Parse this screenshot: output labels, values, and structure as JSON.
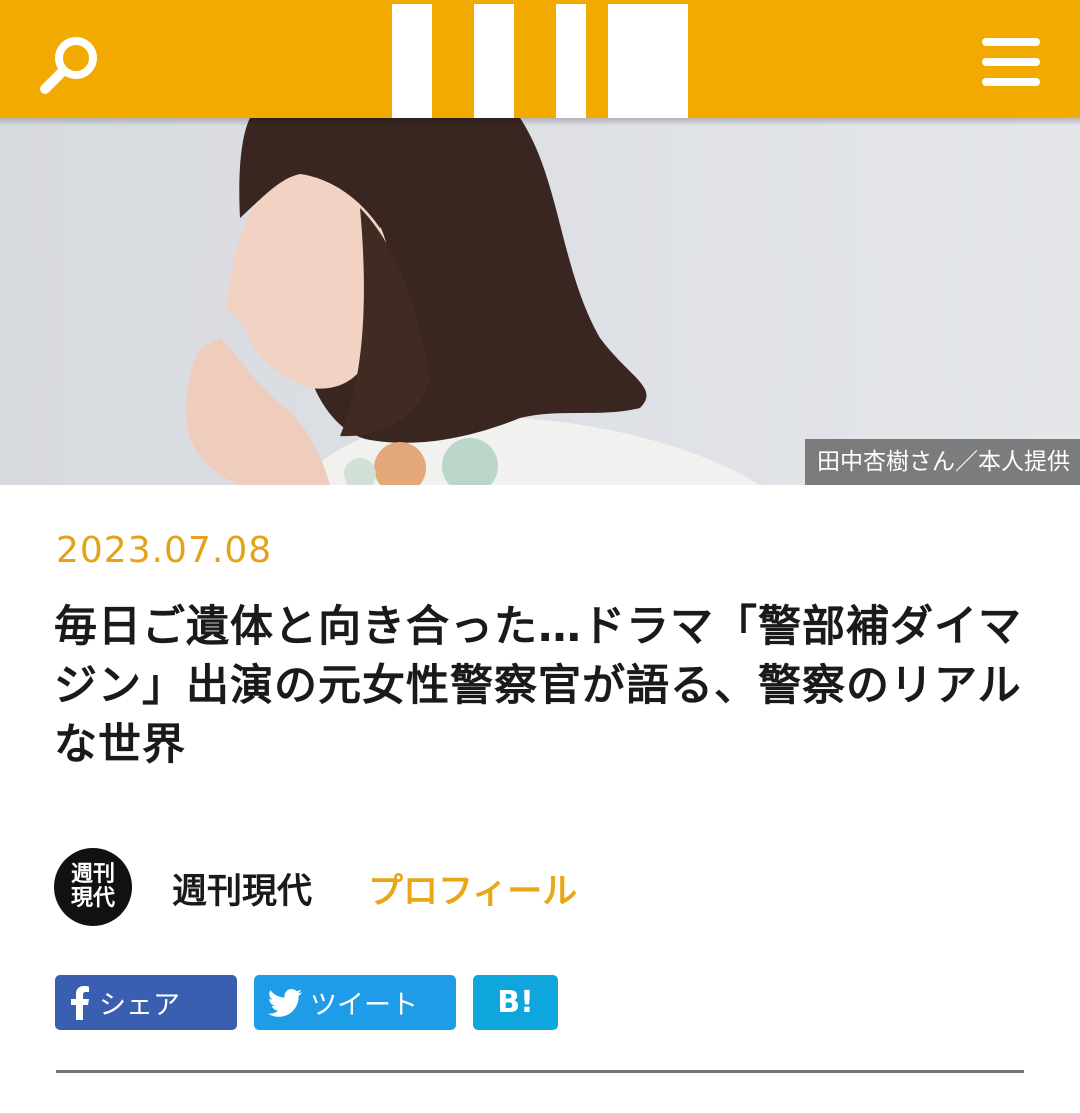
{
  "header": {
    "bg_color": "#f2a900",
    "search_icon": "search-icon",
    "menu_icon": "hamburger-menu-icon"
  },
  "hero": {
    "caption": "田中杏樹さん／本人提供"
  },
  "article": {
    "date": "2023.07.08",
    "title": "毎日ご遺体と向き合った…ドラマ「警部補ダイマジン」出演の元女性警察官が語る、警察のリアルな世界",
    "author_logo_line1": "週刊",
    "author_logo_line2": "現代",
    "author_name": "週刊現代",
    "profile_link": "プロフィール",
    "accent_color": "#e9a616"
  },
  "share": {
    "facebook_label": "シェア",
    "twitter_label": "ツイート",
    "hatena_label": "B!",
    "facebook_color": "#3b5fb0",
    "twitter_color": "#1f9ce8",
    "hatena_color": "#0fa5dd"
  }
}
